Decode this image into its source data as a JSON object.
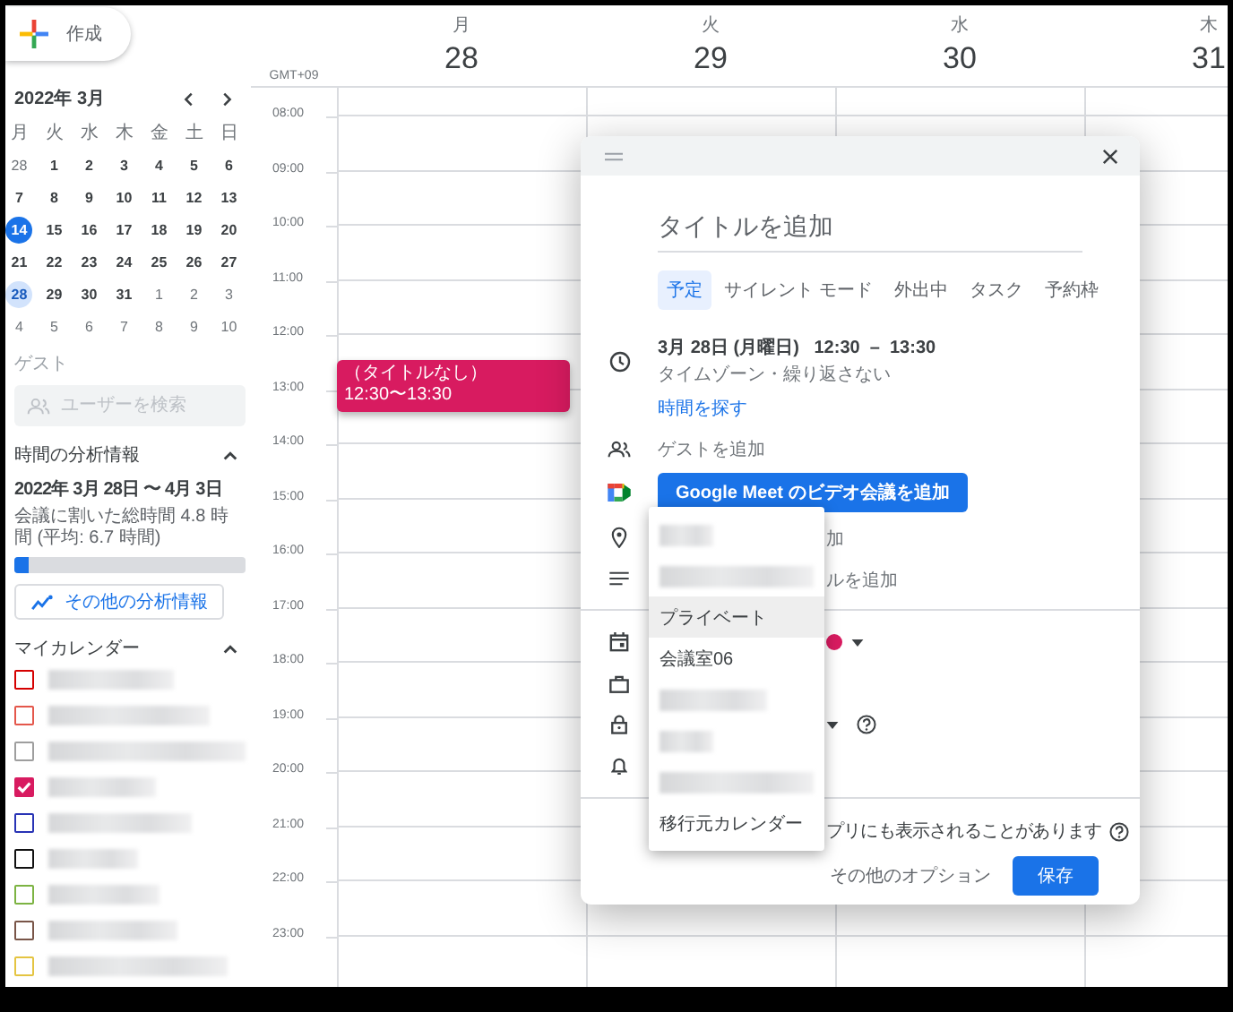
{
  "create_button": {
    "label": "作成"
  },
  "mini_calendar": {
    "title": "2022年 3月",
    "weekdays": [
      "月",
      "火",
      "水",
      "木",
      "金",
      "土",
      "日"
    ],
    "weeks": [
      [
        {
          "d": "28",
          "in_month": false,
          "today": false,
          "selected": false
        },
        {
          "d": "1",
          "in_month": true,
          "today": false,
          "selected": false
        },
        {
          "d": "2",
          "in_month": true,
          "today": false,
          "selected": false
        },
        {
          "d": "3",
          "in_month": true,
          "today": false,
          "selected": false
        },
        {
          "d": "4",
          "in_month": true,
          "today": false,
          "selected": false
        },
        {
          "d": "5",
          "in_month": true,
          "today": false,
          "selected": false
        },
        {
          "d": "6",
          "in_month": true,
          "today": false,
          "selected": false
        }
      ],
      [
        {
          "d": "7",
          "in_month": true,
          "today": false,
          "selected": false
        },
        {
          "d": "8",
          "in_month": true,
          "today": false,
          "selected": false
        },
        {
          "d": "9",
          "in_month": true,
          "today": false,
          "selected": false
        },
        {
          "d": "10",
          "in_month": true,
          "today": false,
          "selected": false
        },
        {
          "d": "11",
          "in_month": true,
          "today": false,
          "selected": false
        },
        {
          "d": "12",
          "in_month": true,
          "today": false,
          "selected": false
        },
        {
          "d": "13",
          "in_month": true,
          "today": false,
          "selected": false
        }
      ],
      [
        {
          "d": "14",
          "in_month": true,
          "today": true,
          "selected": false
        },
        {
          "d": "15",
          "in_month": true,
          "today": false,
          "selected": false
        },
        {
          "d": "16",
          "in_month": true,
          "today": false,
          "selected": false
        },
        {
          "d": "17",
          "in_month": true,
          "today": false,
          "selected": false
        },
        {
          "d": "18",
          "in_month": true,
          "today": false,
          "selected": false
        },
        {
          "d": "19",
          "in_month": true,
          "today": false,
          "selected": false
        },
        {
          "d": "20",
          "in_month": true,
          "today": false,
          "selected": false
        }
      ],
      [
        {
          "d": "21",
          "in_month": true,
          "today": false,
          "selected": false
        },
        {
          "d": "22",
          "in_month": true,
          "today": false,
          "selected": false
        },
        {
          "d": "23",
          "in_month": true,
          "today": false,
          "selected": false
        },
        {
          "d": "24",
          "in_month": true,
          "today": false,
          "selected": false
        },
        {
          "d": "25",
          "in_month": true,
          "today": false,
          "selected": false
        },
        {
          "d": "26",
          "in_month": true,
          "today": false,
          "selected": false
        },
        {
          "d": "27",
          "in_month": true,
          "today": false,
          "selected": false
        }
      ],
      [
        {
          "d": "28",
          "in_month": true,
          "today": false,
          "selected": true
        },
        {
          "d": "29",
          "in_month": true,
          "today": false,
          "selected": false
        },
        {
          "d": "30",
          "in_month": true,
          "today": false,
          "selected": false
        },
        {
          "d": "31",
          "in_month": true,
          "today": false,
          "selected": false
        },
        {
          "d": "1",
          "in_month": false,
          "today": false,
          "selected": false
        },
        {
          "d": "2",
          "in_month": false,
          "today": false,
          "selected": false
        },
        {
          "d": "3",
          "in_month": false,
          "today": false,
          "selected": false
        }
      ],
      [
        {
          "d": "4",
          "in_month": false,
          "today": false,
          "selected": false
        },
        {
          "d": "5",
          "in_month": false,
          "today": false,
          "selected": false
        },
        {
          "d": "6",
          "in_month": false,
          "today": false,
          "selected": false
        },
        {
          "d": "7",
          "in_month": false,
          "today": false,
          "selected": false
        },
        {
          "d": "8",
          "in_month": false,
          "today": false,
          "selected": false
        },
        {
          "d": "9",
          "in_month": false,
          "today": false,
          "selected": false
        },
        {
          "d": "10",
          "in_month": false,
          "today": false,
          "selected": false
        }
      ]
    ]
  },
  "guests": {
    "heading": "ゲスト",
    "placeholder": "ユーザーを検索"
  },
  "time_insights": {
    "heading": "時間の分析情報",
    "range": "2022年 3月 28日 〜 4月 3日",
    "summary": "会議に割いた総時間 4.8 時間 (平均: 6.7 時間)",
    "level": 0.06,
    "button": "その他の分析情報"
  },
  "my_calendars": {
    "heading": "マイカレンダー",
    "items": [
      {
        "color": "#d50000",
        "checked": false
      },
      {
        "color": "#e4574b",
        "checked": false
      },
      {
        "color": "#9e9e9e",
        "checked": false
      },
      {
        "color": "#d81b60",
        "checked": true
      },
      {
        "color": "#2833b5",
        "checked": false
      },
      {
        "color": "#111111",
        "checked": false
      },
      {
        "color": "#7cb342",
        "checked": false
      },
      {
        "color": "#795548",
        "checked": false
      },
      {
        "color": "#e4c441",
        "checked": false
      }
    ]
  },
  "timezone": "GMT+09",
  "days": [
    {
      "weekday": "月",
      "date": "28",
      "events": [
        {
          "title": "（タイトルなし）",
          "time": "12:30〜13:30",
          "color": "#d81b60"
        }
      ]
    },
    {
      "weekday": "火",
      "date": "29"
    },
    {
      "weekday": "水",
      "date": "30"
    },
    {
      "weekday": "木",
      "date": "31"
    }
  ],
  "hours": [
    "08:00",
    "09:00",
    "10:00",
    "11:00",
    "12:00",
    "13:00",
    "14:00",
    "15:00",
    "16:00",
    "17:00",
    "18:00",
    "19:00",
    "20:00",
    "21:00",
    "22:00",
    "23:00"
  ],
  "dialog": {
    "title_placeholder": "タイトルを追加",
    "tabs": [
      {
        "label": "予定",
        "selected": true
      },
      {
        "label": "サイレント モード",
        "selected": false
      },
      {
        "label": "外出中",
        "selected": false
      },
      {
        "label": "タスク",
        "selected": false
      },
      {
        "label": "予約枠",
        "selected": false
      }
    ],
    "date_time": "3月 28日 (月曜日)   12:30  –  13:30",
    "date_sub": "タイムゾーン・繰り返さない",
    "find_time": "時間を探す",
    "add_guests": "ゲストを追加",
    "meet_button": "Google Meet のビデオ会議を追加",
    "location_partial": "加",
    "description_partial": "ルを追加",
    "notice_partial": "プリにも表示されることがあります",
    "more_options": "その他のオプション",
    "save": "保存"
  },
  "calendar_menu": [
    {
      "kind": "blurred",
      "selected": false
    },
    {
      "kind": "blurred",
      "selected": false
    },
    {
      "kind": "text",
      "label": "プライベート",
      "selected": true
    },
    {
      "kind": "text",
      "label": "会議室06",
      "selected": false
    },
    {
      "kind": "blurred",
      "selected": false
    },
    {
      "kind": "blurred",
      "selected": false
    },
    {
      "kind": "blurred",
      "selected": false
    },
    {
      "kind": "text",
      "label": "移行元カレンダー",
      "selected": false
    }
  ]
}
